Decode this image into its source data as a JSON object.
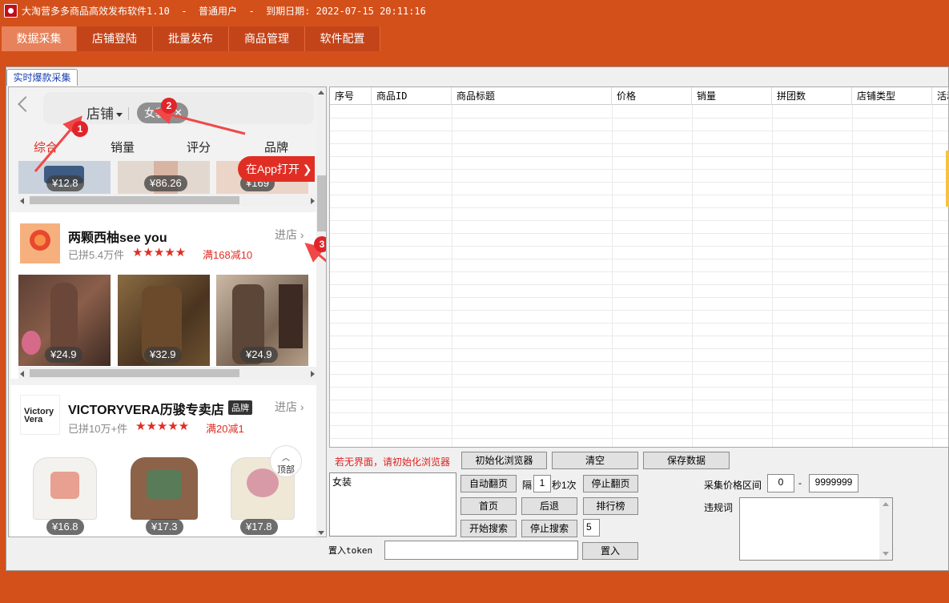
{
  "titlebar": {
    "text": "大淘营多多商品高效发布软件1.10  -  普通用户  -  到期日期: 2022-07-15 20:11:16"
  },
  "menu": [
    "数据采集",
    "店铺登陆",
    "批量发布",
    "商品管理",
    "软件配置"
  ],
  "tab_label": "实时爆款采集",
  "browser": {
    "search_scope": "店铺",
    "search_tag": "女装",
    "sort_tabs": [
      "综合",
      "销量",
      "评分",
      "品牌"
    ],
    "open_in_app": "在App打开",
    "top_prices": [
      "¥12.8",
      "¥86.26",
      "¥169"
    ],
    "shop1": {
      "name": "两颗西柚see you",
      "sold": "已拼5.4万件",
      "stars": "★★★★★",
      "promo": "满168减10",
      "enter": "进店",
      "prices": [
        "¥24.9",
        "¥32.9",
        "¥24.9"
      ]
    },
    "shop2": {
      "name": "VICTORYVERA历骏专卖店",
      "brand_badge": "品牌",
      "sold": "已拼10万+件",
      "stars": "★★★★★",
      "promo": "满20减1",
      "enter": "进店",
      "prices": [
        "¥16.8",
        "¥17.3",
        "¥17.8"
      ]
    },
    "top_button": "顶部",
    "annotations": [
      "1",
      "2",
      "3"
    ]
  },
  "grid": {
    "columns": [
      "序号",
      "商品ID",
      "商品标题",
      "价格",
      "销量",
      "拼团数",
      "店铺类型",
      "活动"
    ]
  },
  "controls": {
    "warning": "若无界面，请初始化浏览器",
    "init_browser": "初始化浏览器",
    "clear": "清空",
    "save_data": "保存数据",
    "keyword_text": "女装",
    "auto_page": "自动翻页",
    "interval_prefix": "隔",
    "interval_value": "1",
    "interval_suffix": "秒1次",
    "stop_page": "停止翻页",
    "first_page": "首页",
    "back": "后退",
    "ranking": "排行榜",
    "start_search": "开始搜索",
    "stop_search": "停止搜索",
    "search_count": "5",
    "token_label": "置入token",
    "token_value": "",
    "set_button": "置入",
    "price_range_label": "采集价格区间",
    "price_min": "0",
    "price_dash": "-",
    "price_max": "9999999",
    "forbidden_label": "违规词",
    "forbidden_value": ""
  },
  "colors": {
    "brand": "#d4501a",
    "menu": "#c4441a",
    "menu_active": "#e7825a",
    "accent_red": "#e02e24",
    "warning": "#e02020"
  }
}
